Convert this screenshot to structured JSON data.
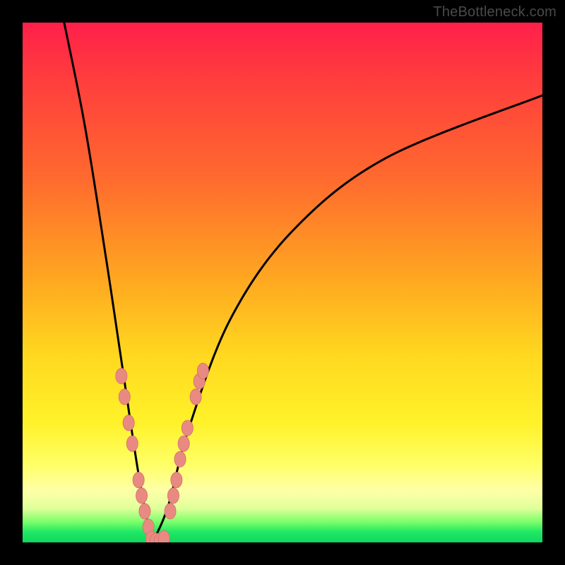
{
  "watermark": "TheBottleneck.com",
  "colors": {
    "frame": "#000000",
    "curve_stroke": "#000000",
    "marker_fill": "#e98a82",
    "marker_stroke": "#d8766f"
  },
  "chart_data": {
    "type": "line",
    "title": "",
    "xlabel": "",
    "ylabel": "",
    "xlim": [
      0,
      100
    ],
    "ylim": [
      0,
      100
    ],
    "curve": {
      "minimum_x": 25,
      "left_branch": [
        {
          "x": 8,
          "y": 100
        },
        {
          "x": 12,
          "y": 80
        },
        {
          "x": 16,
          "y": 55
        },
        {
          "x": 19,
          "y": 35
        },
        {
          "x": 22,
          "y": 15
        },
        {
          "x": 24,
          "y": 4
        },
        {
          "x": 25,
          "y": 0
        }
      ],
      "right_branch": [
        {
          "x": 25,
          "y": 0
        },
        {
          "x": 28,
          "y": 7
        },
        {
          "x": 32,
          "y": 22
        },
        {
          "x": 40,
          "y": 43
        },
        {
          "x": 52,
          "y": 60
        },
        {
          "x": 70,
          "y": 74
        },
        {
          "x": 100,
          "y": 86
        }
      ]
    },
    "markers_left": [
      {
        "x": 19.0,
        "y": 32
      },
      {
        "x": 19.6,
        "y": 28
      },
      {
        "x": 20.4,
        "y": 23
      },
      {
        "x": 21.1,
        "y": 19
      },
      {
        "x": 22.3,
        "y": 12
      },
      {
        "x": 22.9,
        "y": 9
      },
      {
        "x": 23.5,
        "y": 6
      },
      {
        "x": 24.2,
        "y": 3
      }
    ],
    "markers_bottom": [
      {
        "x": 24.8,
        "y": 0.7
      },
      {
        "x": 25.6,
        "y": 0.3
      },
      {
        "x": 26.4,
        "y": 0.3
      },
      {
        "x": 27.2,
        "y": 0.8
      }
    ],
    "markers_right": [
      {
        "x": 28.4,
        "y": 6
      },
      {
        "x": 29.0,
        "y": 9
      },
      {
        "x": 29.6,
        "y": 12
      },
      {
        "x": 30.3,
        "y": 16
      },
      {
        "x": 31.0,
        "y": 19
      },
      {
        "x": 31.7,
        "y": 22
      },
      {
        "x": 33.3,
        "y": 28
      },
      {
        "x": 34.0,
        "y": 31
      },
      {
        "x": 34.7,
        "y": 33
      }
    ]
  }
}
